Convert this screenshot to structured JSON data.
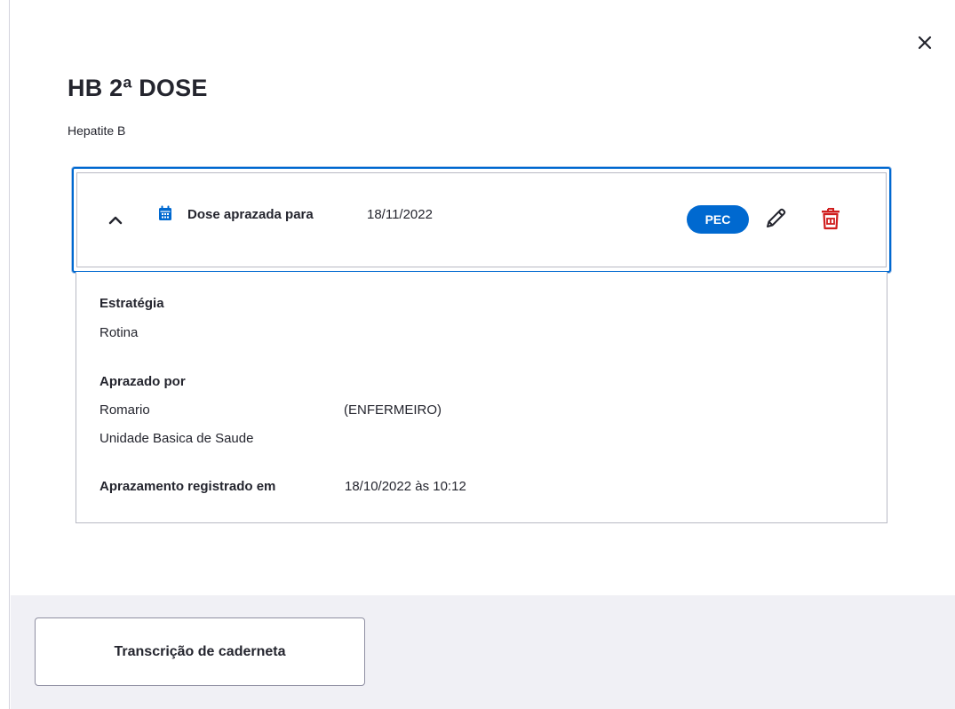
{
  "header": {
    "title": "HB 2ª DOSE",
    "subtitle": "Hepatite B",
    "close_icon": "close-icon"
  },
  "dose_card": {
    "expand_icon": "chevron-up-icon",
    "calendar_icon": "calendar-icon",
    "dose_label": "Dose aprazada para",
    "dose_date": "18/11/2022",
    "badge": "PEC",
    "edit_icon": "pencil-icon",
    "delete_icon": "trash-icon",
    "accent_color": "#0069d0",
    "delete_color": "#d01e1e",
    "details": {
      "estrategia_label": "Estratégia",
      "estrategia_value": "Rotina",
      "aprazado_por_label": "Aprazado por",
      "professional_name": "Romario",
      "professional_role": "(ENFERMEIRO)",
      "unit": "Unidade Basica de Saude",
      "registered_label": "Aprazamento registrado em",
      "registered_value": "18/10/2022 às 10:12"
    }
  },
  "footer": {
    "button_label": "Transcrição de caderneta"
  }
}
